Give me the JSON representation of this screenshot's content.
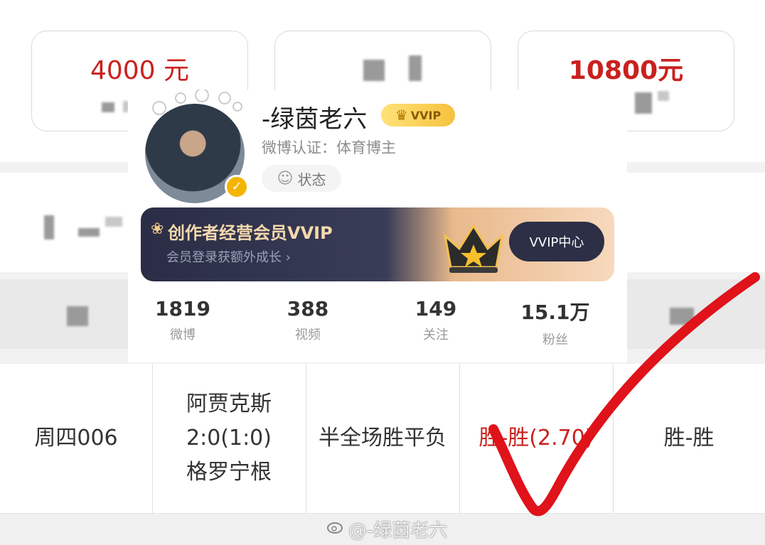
{
  "cards": [
    {
      "amount": "4000 元"
    },
    {
      "amount": ""
    },
    {
      "amount": "10800元"
    }
  ],
  "table": {
    "row": {
      "date": "周四006",
      "match": "阿贾克斯\n2:0(1:0)\n格罗宁根",
      "play_type": "半全场胜平负",
      "pick": "胜-胜(2.70)",
      "result": "胜-胜"
    }
  },
  "profile": {
    "nickname": "-绿茵老六",
    "vip_tag": "VVIP",
    "verify": "微博认证：体育博主",
    "status_label": "状态",
    "banner": {
      "title": "创作者经营会员VVIP",
      "subtitle": "会员登录获额外成长 ›",
      "button": "VVIP中心"
    },
    "stats": [
      {
        "value": "1819",
        "label": "微博"
      },
      {
        "value": "388",
        "label": "视频"
      },
      {
        "value": "149",
        "label": "关注"
      },
      {
        "value": "15.1万",
        "label": "粉丝"
      }
    ]
  },
  "watermark": "@-绿茵老六",
  "colors": {
    "accent_red": "#c9211e",
    "check_red": "#e0121a",
    "vip_gold": "#f6c23e",
    "banner_dark": "#2a2d45"
  }
}
